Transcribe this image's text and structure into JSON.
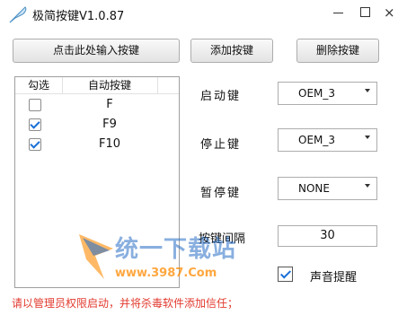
{
  "window": {
    "title": "极简按键V1.0.87",
    "controls": {
      "minimize": "minimize",
      "maximize": "maximize",
      "close": "×"
    }
  },
  "toolbar": {
    "input_button": "点击此处输入按键",
    "add_button": "添加按键",
    "delete_button": "删除按键"
  },
  "key_list": {
    "headers": {
      "check": "勾选",
      "key": "自动按键"
    },
    "rows": [
      {
        "checked": false,
        "key": "F"
      },
      {
        "checked": true,
        "key": "F9"
      },
      {
        "checked": true,
        "key": "F10"
      }
    ]
  },
  "settings": {
    "start_key": {
      "label": "启动键",
      "value": "OEM_3"
    },
    "stop_key": {
      "label": "停止键",
      "value": "OEM_3"
    },
    "pause_key": {
      "label": "暂停键",
      "value": "NONE"
    },
    "interval": {
      "label": "按键间隔",
      "value": "30"
    },
    "sound": {
      "label": "声音提醒",
      "checked": true
    }
  },
  "note": "请以管理员权限启动，并将杀毒软件添加信任；",
  "watermark": {
    "text": "统一下载站",
    "url": "www.3987.Com"
  },
  "icons": {
    "app": "feather-pen-icon",
    "dropdown": "chevron-down-icon",
    "check": "checkmark-icon"
  },
  "colors": {
    "note": "#e23a2f",
    "checkmark": "#1a6fd6",
    "watermark_blue": "#2a6fc6",
    "watermark_orange": "#ff8a00"
  }
}
